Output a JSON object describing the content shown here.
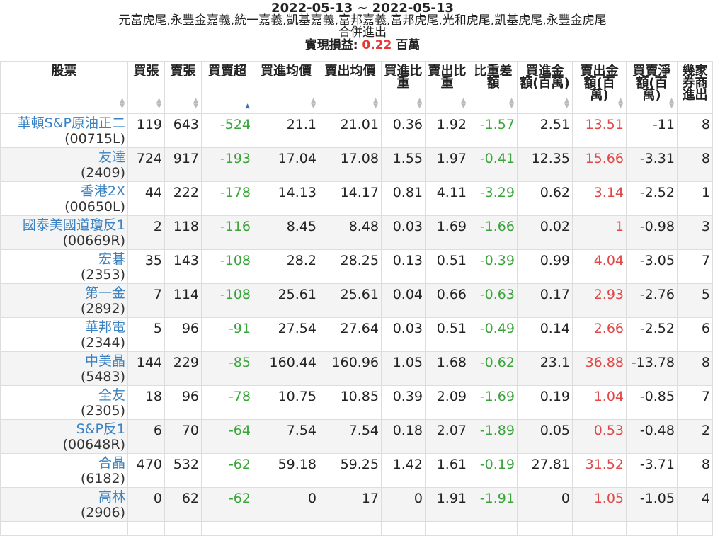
{
  "header": {
    "date_range": "2022-05-13 ~ 2022-05-13",
    "brokers": "元富虎尾,永豐金嘉義,統一嘉義,凱基嘉義,富邦嘉義,富邦虎尾,光和虎尾,凱基虎尾,永豐金虎尾",
    "merge_label": "合併進出",
    "profit_label": "實現損益: ",
    "profit_value": "0.22",
    "profit_unit": " 百萬"
  },
  "columns": [
    {
      "key": "stock",
      "label": "股票"
    },
    {
      "key": "buy",
      "label": "買張"
    },
    {
      "key": "sell",
      "label": "賣張"
    },
    {
      "key": "net",
      "label": "買賣超",
      "sorted": true
    },
    {
      "key": "avg_buy",
      "label": "買進均價"
    },
    {
      "key": "avg_sell",
      "label": "賣出均價"
    },
    {
      "key": "buy_ratio",
      "label": "買進比重"
    },
    {
      "key": "sell_ratio",
      "label": "賣出比重"
    },
    {
      "key": "ratio_diff",
      "label": "比重差額"
    },
    {
      "key": "buy_amt",
      "label": "買進金額(百萬)"
    },
    {
      "key": "sell_amt",
      "label": "賣出金額(百萬)"
    },
    {
      "key": "net_amt",
      "label": "買賣淨額(百萬)"
    },
    {
      "key": "brokers",
      "label": "幾家券商進出"
    }
  ],
  "rows": [
    {
      "name": "華頓S&P原油正二",
      "code": "(00715L)",
      "buy": "119",
      "sell": "643",
      "net": "-524",
      "avg_buy": "21.1",
      "avg_sell": "21.01",
      "buy_ratio": "0.36",
      "sell_ratio": "1.92",
      "ratio_diff": "-1.57",
      "buy_amt": "2.51",
      "sell_amt": "13.51",
      "net_amt": "-11",
      "brokers": "8"
    },
    {
      "name": "友達",
      "code": "(2409)",
      "buy": "724",
      "sell": "917",
      "net": "-193",
      "avg_buy": "17.04",
      "avg_sell": "17.08",
      "buy_ratio": "1.55",
      "sell_ratio": "1.97",
      "ratio_diff": "-0.41",
      "buy_amt": "12.35",
      "sell_amt": "15.66",
      "net_amt": "-3.31",
      "brokers": "8"
    },
    {
      "name": "香港2X",
      "code": "(00650L)",
      "buy": "44",
      "sell": "222",
      "net": "-178",
      "avg_buy": "14.13",
      "avg_sell": "14.17",
      "buy_ratio": "0.81",
      "sell_ratio": "4.11",
      "ratio_diff": "-3.29",
      "buy_amt": "0.62",
      "sell_amt": "3.14",
      "net_amt": "-2.52",
      "brokers": "1"
    },
    {
      "name": "國泰美國道瓊反1",
      "code": "(00669R)",
      "buy": "2",
      "sell": "118",
      "net": "-116",
      "avg_buy": "8.45",
      "avg_sell": "8.48",
      "buy_ratio": "0.03",
      "sell_ratio": "1.69",
      "ratio_diff": "-1.66",
      "buy_amt": "0.02",
      "sell_amt": "1",
      "net_amt": "-0.98",
      "brokers": "3"
    },
    {
      "name": "宏碁",
      "code": "(2353)",
      "buy": "35",
      "sell": "143",
      "net": "-108",
      "avg_buy": "28.2",
      "avg_sell": "28.25",
      "buy_ratio": "0.13",
      "sell_ratio": "0.51",
      "ratio_diff": "-0.39",
      "buy_amt": "0.99",
      "sell_amt": "4.04",
      "net_amt": "-3.05",
      "brokers": "7"
    },
    {
      "name": "第一金",
      "code": "(2892)",
      "buy": "7",
      "sell": "114",
      "net": "-108",
      "avg_buy": "25.61",
      "avg_sell": "25.61",
      "buy_ratio": "0.04",
      "sell_ratio": "0.66",
      "ratio_diff": "-0.63",
      "buy_amt": "0.17",
      "sell_amt": "2.93",
      "net_amt": "-2.76",
      "brokers": "5"
    },
    {
      "name": "華邦電",
      "code": "(2344)",
      "buy": "5",
      "sell": "96",
      "net": "-91",
      "avg_buy": "27.54",
      "avg_sell": "27.64",
      "buy_ratio": "0.03",
      "sell_ratio": "0.51",
      "ratio_diff": "-0.49",
      "buy_amt": "0.14",
      "sell_amt": "2.66",
      "net_amt": "-2.52",
      "brokers": "6"
    },
    {
      "name": "中美晶",
      "code": "(5483)",
      "buy": "144",
      "sell": "229",
      "net": "-85",
      "avg_buy": "160.44",
      "avg_sell": "160.96",
      "buy_ratio": "1.05",
      "sell_ratio": "1.68",
      "ratio_diff": "-0.62",
      "buy_amt": "23.1",
      "sell_amt": "36.88",
      "net_amt": "-13.78",
      "brokers": "8"
    },
    {
      "name": "全友",
      "code": "(2305)",
      "buy": "18",
      "sell": "96",
      "net": "-78",
      "avg_buy": "10.75",
      "avg_sell": "10.85",
      "buy_ratio": "0.39",
      "sell_ratio": "2.09",
      "ratio_diff": "-1.69",
      "buy_amt": "0.19",
      "sell_amt": "1.04",
      "net_amt": "-0.85",
      "brokers": "7"
    },
    {
      "name": "S&P反1",
      "code": "(00648R)",
      "buy": "6",
      "sell": "70",
      "net": "-64",
      "avg_buy": "7.54",
      "avg_sell": "7.54",
      "buy_ratio": "0.18",
      "sell_ratio": "2.07",
      "ratio_diff": "-1.89",
      "buy_amt": "0.05",
      "sell_amt": "0.53",
      "net_amt": "-0.48",
      "brokers": "2"
    },
    {
      "name": "合晶",
      "code": "(6182)",
      "buy": "470",
      "sell": "532",
      "net": "-62",
      "avg_buy": "59.18",
      "avg_sell": "59.25",
      "buy_ratio": "1.42",
      "sell_ratio": "1.61",
      "ratio_diff": "-0.19",
      "buy_amt": "27.81",
      "sell_amt": "31.52",
      "net_amt": "-3.71",
      "brokers": "8"
    },
    {
      "name": "高林",
      "code": "(2906)",
      "buy": "0",
      "sell": "62",
      "net": "-62",
      "avg_buy": "0",
      "avg_sell": "17",
      "buy_ratio": "0",
      "sell_ratio": "1.91",
      "ratio_diff": "-1.91",
      "buy_amt": "0",
      "sell_amt": "1.05",
      "net_amt": "-1.05",
      "brokers": "4"
    }
  ],
  "colors": {
    "link": "#3a82c1",
    "positive": "#3aa33a",
    "negative": "#e04848"
  }
}
